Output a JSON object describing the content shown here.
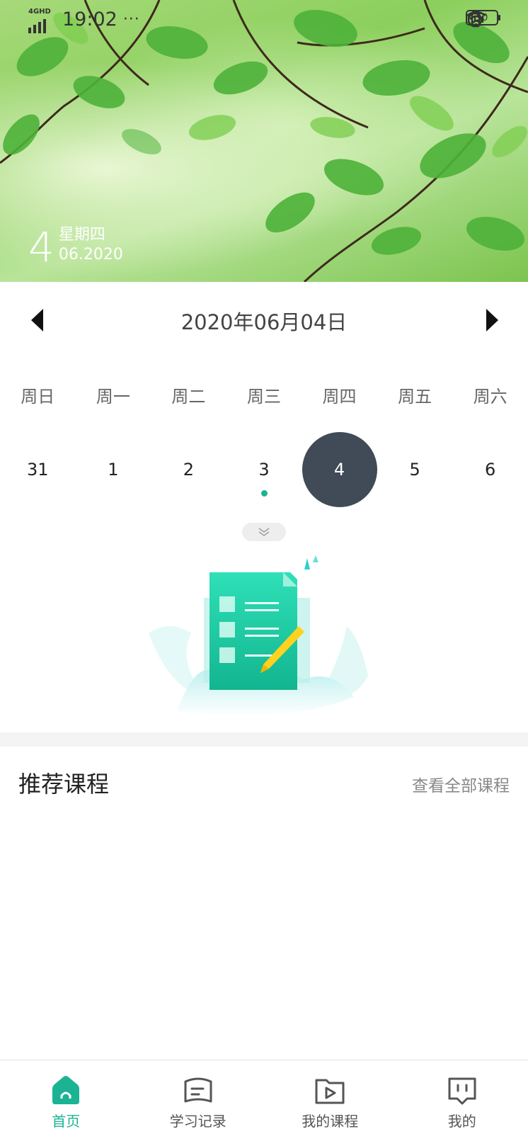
{
  "status_bar": {
    "network": "4GHD",
    "time": "19:02",
    "more": "···",
    "battery": "50"
  },
  "hero": {
    "day": "4",
    "weekday": "星期四",
    "month_year": "06.2020"
  },
  "calendar": {
    "title": "2020年06月04日",
    "weekdays": [
      "周日",
      "周一",
      "周二",
      "周三",
      "周四",
      "周五",
      "周六"
    ],
    "dates": [
      "31",
      "1",
      "2",
      "3",
      "4",
      "5",
      "6"
    ],
    "selected": "4",
    "event_dates": [
      "3"
    ]
  },
  "recommend": {
    "title": "推荐课程",
    "view_all": "查看全部课程"
  },
  "tabs": [
    {
      "label": "首页",
      "icon": "home-icon",
      "active": true
    },
    {
      "label": "学习记录",
      "icon": "study-record-icon",
      "active": false
    },
    {
      "label": "我的课程",
      "icon": "my-courses-icon",
      "active": false
    },
    {
      "label": "我的",
      "icon": "profile-icon",
      "active": false
    }
  ],
  "colors": {
    "accent": "#1bb394",
    "selected_circle": "#404b57"
  }
}
